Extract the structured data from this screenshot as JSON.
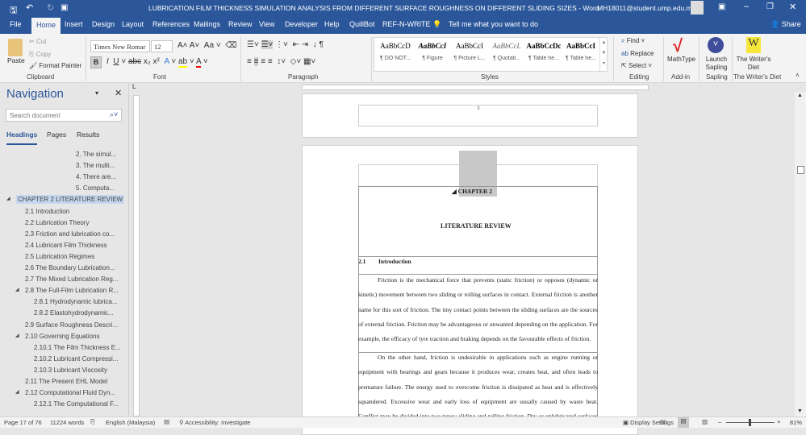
{
  "title_bar": {
    "title": "LUBRICATION FILM THICKNESS SIMULATION ANALYSIS FROM DIFFERENT SURFACE ROUGHNESS ON DIFFERENT SLIDING SIZES  -  Word",
    "account": "MH18011@student.ump.edu.my"
  },
  "tabs": [
    "File",
    "Home",
    "Insert",
    "Design",
    "Layout",
    "References",
    "Mailings",
    "Review",
    "View",
    "Developer",
    "Help",
    "QuillBot",
    "REF-N-WRITE"
  ],
  "tell_me": "Tell me what you want to do",
  "share": "Share",
  "clipboard": {
    "paste": "Paste",
    "cut": "Cut",
    "copy": "Copy",
    "format_painter": "Format Painter",
    "label": "Clipboard"
  },
  "font": {
    "name": "Times New Romar",
    "size": "12",
    "label": "Font"
  },
  "paragraph": {
    "label": "Paragraph"
  },
  "styles": {
    "label": "Styles",
    "items": [
      {
        "preview": "AaBbCcD",
        "name": "¶ DO NOT..."
      },
      {
        "preview": "AaBbCcI",
        "name": "¶ Figure"
      },
      {
        "preview": "AaBbCcI",
        "name": "¶ Picture L..."
      },
      {
        "preview": "AaBbCcL",
        "name": "¶ Quotati..."
      },
      {
        "preview": "AaBbCcDc",
        "name": "¶ Table he..."
      },
      {
        "preview": "AaBbCcI",
        "name": "¶ Table he..."
      }
    ]
  },
  "editing": {
    "find": "Find",
    "replace": "Replace",
    "select": "Select",
    "label": "Editing"
  },
  "addins": [
    {
      "name": "MathType",
      "group": "Add-in"
    },
    {
      "name": "Launch Sapling",
      "group": "Sapling"
    },
    {
      "name": "The Writer's Diet",
      "group": "The Writer's Diet"
    }
  ],
  "navigation": {
    "title": "Navigation",
    "search_placeholder": "Search document",
    "tabs": [
      "Headings",
      "Pages",
      "Results"
    ],
    "items": [
      {
        "text": "2. The simul...",
        "level": 3
      },
      {
        "text": "3. The multi...",
        "level": 3
      },
      {
        "text": "4. There are...",
        "level": 3
      },
      {
        "text": "5. Computa...",
        "level": 3
      },
      {
        "text": "CHAPTER 2    LITERATURE REVIEW",
        "level": 0,
        "selected": true
      },
      {
        "text": "2.1 Introduction",
        "level": 1
      },
      {
        "text": "2.2 Lubrication Theory",
        "level": 1
      },
      {
        "text": "2.3 Friction and lubrication co...",
        "level": 1
      },
      {
        "text": "2.4 Lubricant Film Thickness",
        "level": 1
      },
      {
        "text": "2.5 Lubrication Regimes",
        "level": 1
      },
      {
        "text": "2.6 The Boundary Lubrication...",
        "level": 1
      },
      {
        "text": "2.7 The Mixed Lubrication Reg...",
        "level": 1
      },
      {
        "text": "2.8 The Full-Film Lubrication R...",
        "level": 1,
        "expand": true
      },
      {
        "text": "2.8.1 Hydrodynamic lubrica...",
        "level": 2
      },
      {
        "text": "2.8.2  Elastohydrodynamic...",
        "level": 2
      },
      {
        "text": "2.9 Surface Roughness Descri...",
        "level": 1
      },
      {
        "text": "2.10 Governing Equations",
        "level": 1,
        "expand": true
      },
      {
        "text": "2.10.1 The Film Thickness E...",
        "level": 2
      },
      {
        "text": "2.10.2 Lubricant Compressi...",
        "level": 2
      },
      {
        "text": "2.10.3 Lubricant Viscosity",
        "level": 2
      },
      {
        "text": "2.11 The Present EHL Model",
        "level": 1
      },
      {
        "text": "2.12 Computational Fluid Dyn...",
        "level": 1,
        "expand": true
      },
      {
        "text": "2.12.1 The Computational F...",
        "level": 2
      }
    ]
  },
  "document": {
    "page_number": "3",
    "chapter": "CHAPTER 2",
    "heading": "LITERATURE REVIEW",
    "section_num": "2.1",
    "section_title": "Introduction",
    "para1": "Friction is the mechanical force that prevents (static friction) or opposes (dynamic or kinetic) movement between two sliding or rolling surfaces in contact. External friction is another name for this sort of friction. The tiny contact points between the sliding surfaces are the sources of external friction. Friction may be advantageous or unwanted depending on the application. For example, the efficacy of tyre traction and braking depends on the favourable effects of friction.",
    "para2": "On the other hand, friction is undesirable in applications such as engine running or equipment with bearings and gears because it produces wear, creates heat, and often leads to premature failure. The energy used to overcome friction is dissipated as heat and is effectively squandered. Excessive wear and early loss of equipment are usually caused by waste heat. Conflict may be divided into two types: sliding and rolling friction. Dry or unlubricated surfaces and lubricated surfaces have different relationships between"
  },
  "status": {
    "page": "Page 17 of 76",
    "words": "11224 words",
    "language": "English (Malaysia)",
    "accessibility": "Accessibility: Investigate",
    "display_settings": "Display Settings",
    "zoom": "81%"
  },
  "colors": {
    "brand": "#2b579a"
  }
}
